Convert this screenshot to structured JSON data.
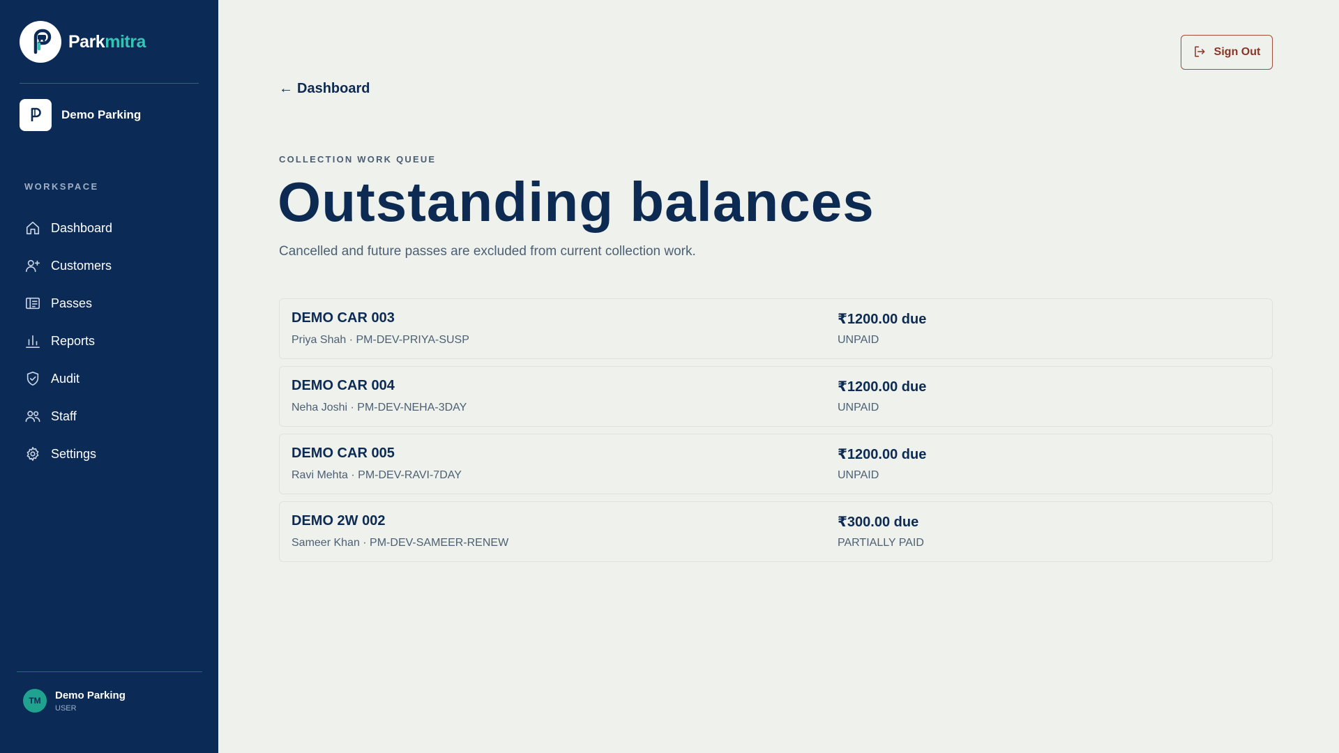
{
  "brand": {
    "name_main": "Park",
    "name_accent": "mitra"
  },
  "org": {
    "name": "Demo Parking"
  },
  "sidebar": {
    "section_label": "WORKSPACE",
    "items": [
      {
        "label": "Dashboard",
        "icon": "home-icon"
      },
      {
        "label": "Customers",
        "icon": "user-plus-icon"
      },
      {
        "label": "Passes",
        "icon": "pass-card-icon"
      },
      {
        "label": "Reports",
        "icon": "bar-chart-icon"
      },
      {
        "label": "Audit",
        "icon": "shield-check-icon"
      },
      {
        "label": "Staff",
        "icon": "users-icon"
      },
      {
        "label": "Settings",
        "icon": "gear-icon"
      }
    ]
  },
  "user": {
    "initials": "TM",
    "name": "Demo Parking",
    "role": "USER"
  },
  "header": {
    "signout_label": "Sign Out",
    "back_arrow": "←",
    "back_label": "Dashboard"
  },
  "main": {
    "eyebrow": "COLLECTION WORK QUEUE",
    "title": "Outstanding balances",
    "subtitle": "Cancelled and future passes are excluded from current collection work.",
    "rows": [
      {
        "plate": "DEMO CAR 003",
        "meta": "Priya Shah · PM-DEV-PRIYA-SUSP",
        "amount": "₹1200.00 due",
        "status": "UNPAID"
      },
      {
        "plate": "DEMO CAR 004",
        "meta": "Neha Joshi · PM-DEV-NEHA-3DAY",
        "amount": "₹1200.00 due",
        "status": "UNPAID"
      },
      {
        "plate": "DEMO CAR 005",
        "meta": "Ravi Mehta · PM-DEV-RAVI-7DAY",
        "amount": "₹1200.00 due",
        "status": "UNPAID"
      },
      {
        "plate": "DEMO 2W 002",
        "meta": "Sameer Khan · PM-DEV-SAMEER-RENEW",
        "amount": "₹300.00 due",
        "status": "PARTIALLY PAID"
      }
    ]
  },
  "colors": {
    "sidebar_bg": "#0b2a55",
    "accent": "#35c3b4",
    "page_bg": "#eef1ec",
    "text_primary": "#0d2b52",
    "signout": "#8a3426"
  }
}
